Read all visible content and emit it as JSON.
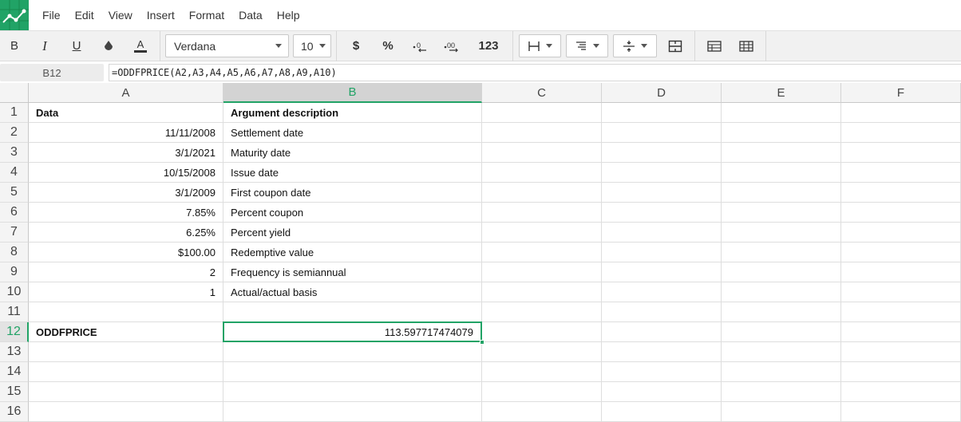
{
  "menu": [
    "File",
    "Edit",
    "View",
    "Insert",
    "Format",
    "Data",
    "Help"
  ],
  "toolbar": {
    "bold": "B",
    "italic": "I",
    "underline": "U",
    "font": "Verdana",
    "size": "10",
    "currency": "$",
    "percent": "%",
    "number_format": "123"
  },
  "formula_bar": {
    "cell_ref": "B12",
    "formula": "=ODDFPRICE(A2,A3,A4,A5,A6,A7,A8,A9,A10)"
  },
  "columns": [
    "A",
    "B",
    "C",
    "D",
    "E",
    "F"
  ],
  "rows": [
    "1",
    "2",
    "3",
    "4",
    "5",
    "6",
    "7",
    "8",
    "9",
    "10",
    "11",
    "12",
    "13",
    "14",
    "15",
    "16"
  ],
  "cells": {
    "A1": "Data",
    "B1": "Argument description",
    "A2": "11/11/2008",
    "B2": "Settlement date",
    "A3": "3/1/2021",
    "B3": "Maturity date",
    "A4": "10/15/2008",
    "B4": "Issue date",
    "A5": "3/1/2009",
    "B5": "First coupon date",
    "A6": "7.85%",
    "B6": "Percent coupon",
    "A7": "6.25%",
    "B7": "Percent yield",
    "A8": "$100.00",
    "B8": "Redemptive value",
    "A9": "2",
    "B9": "Frequency is semiannual",
    "A10": "1",
    "B10": "Actual/actual basis",
    "A12": "ODDFPRICE",
    "B12": "113.597717474079"
  },
  "selection": {
    "cell": "B12",
    "column": "B",
    "row": "12"
  },
  "colors": {
    "accent": "#21a366"
  }
}
